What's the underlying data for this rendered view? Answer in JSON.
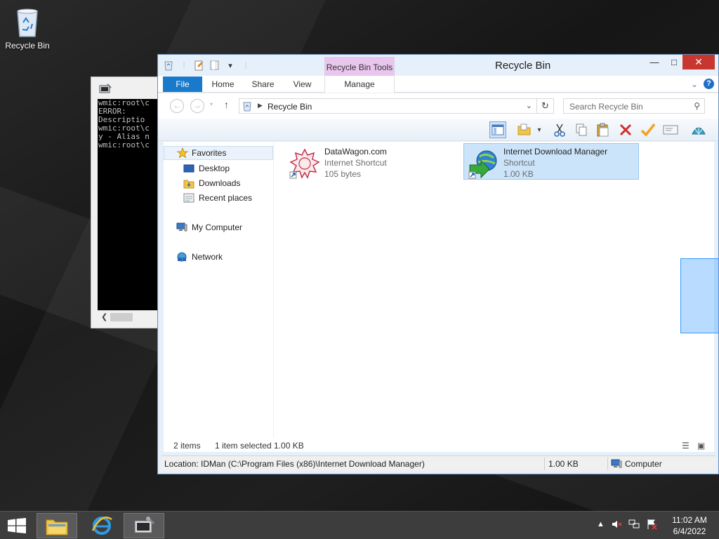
{
  "desktop": {
    "recycle_bin_label": "Recycle Bin"
  },
  "console": {
    "lines": [
      "wmic:root\\c",
      "ERROR:",
      "Descriptio",
      "wmic:root\\c",
      "y - Alias n",
      "wmic:root\\c"
    ]
  },
  "explorer": {
    "title": "Recycle Bin",
    "context_tab_group": "Recycle Bin Tools",
    "ribbon_tabs": {
      "file": "File",
      "home": "Home",
      "share": "Share",
      "view": "View",
      "manage": "Manage"
    },
    "address": {
      "path": "Recycle Bin"
    },
    "search": {
      "placeholder": "Search Recycle Bin"
    },
    "nav": {
      "favorites": "Favorites",
      "desktop": "Desktop",
      "downloads": "Downloads",
      "recent": "Recent places",
      "computer": "My Computer",
      "network": "Network"
    },
    "items": [
      {
        "name": "DataWagon.com",
        "type": "Internet Shortcut",
        "size": "105 bytes"
      },
      {
        "name": "Internet Download Manager",
        "type": "Shortcut",
        "size": "1.00 KB"
      }
    ],
    "status": {
      "count": "2 items",
      "selection": "1 item selected  1.00 KB"
    },
    "location_bar": {
      "location": "Location: IDMan (C:\\Program Files (x86)\\Internet Download Manager)",
      "size": "1.00 KB",
      "zone": "Computer"
    }
  },
  "taskbar": {
    "time": "11:02 AM",
    "date": "6/4/2022"
  },
  "colors": {
    "accent": "#1979ca",
    "selection": "#cce4fa",
    "context_tab": "#e9c6ee",
    "close_button": "#c7372f"
  }
}
